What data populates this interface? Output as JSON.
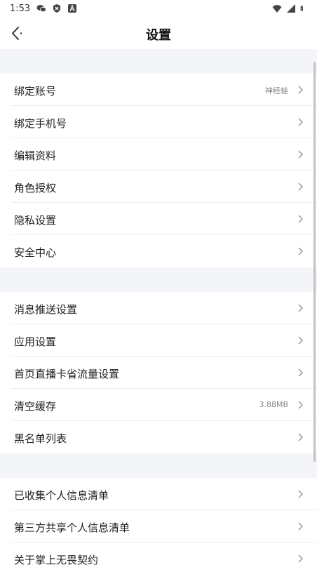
{
  "status": {
    "time": "1:53",
    "left_icons": [
      "wechat-icon",
      "shield-icon",
      "font-icon"
    ],
    "right_icons": [
      "wifi-icon",
      "signal-icon",
      "battery-icon"
    ]
  },
  "header": {
    "title": "设置",
    "back_icon": "chevron-left-icon"
  },
  "groups": [
    {
      "items": [
        {
          "label": "绑定账号",
          "value": "神经蛙"
        },
        {
          "label": "绑定手机号",
          "value": ""
        },
        {
          "label": "编辑资料",
          "value": ""
        },
        {
          "label": "角色授权",
          "value": ""
        },
        {
          "label": "隐私设置",
          "value": ""
        },
        {
          "label": "安全中心",
          "value": ""
        }
      ]
    },
    {
      "items": [
        {
          "label": "消息推送设置",
          "value": ""
        },
        {
          "label": "应用设置",
          "value": ""
        },
        {
          "label": "首页直播卡省流量设置",
          "value": ""
        },
        {
          "label": "清空缓存",
          "value": "3.88MB"
        },
        {
          "label": "黑名单列表",
          "value": ""
        }
      ]
    },
    {
      "items": [
        {
          "label": "已收集个人信息清单",
          "value": ""
        },
        {
          "label": "第三方共享个人信息清单",
          "value": ""
        },
        {
          "label": "关于掌上无畏契约",
          "value": ""
        }
      ]
    }
  ],
  "colors": {
    "section_gap": "#f4f5f8",
    "chevron": "#9a9a9a",
    "divider": "#eeeeee"
  }
}
